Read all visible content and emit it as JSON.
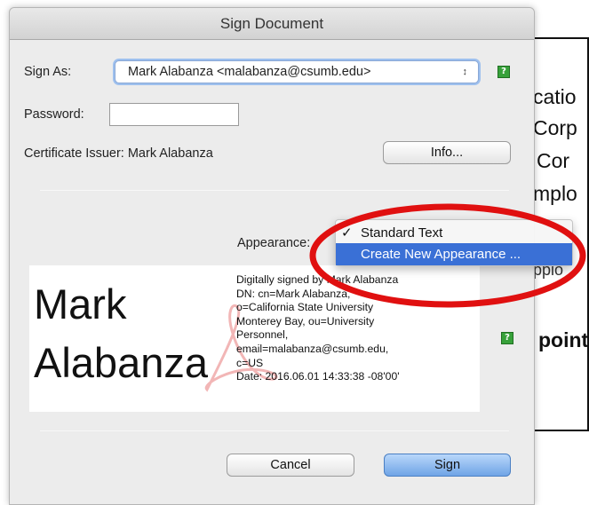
{
  "dialog": {
    "title": "Sign Document",
    "sign_as_label": "Sign As:",
    "sign_as_value": "Mark Alabanza <malabanza@csumb.edu>",
    "password_label": "Password:",
    "password_value": "",
    "certificate_issuer_label": "Certificate Issuer: Mark Alabanza",
    "info_button": "Info...",
    "appearance_label": "Appearance:",
    "cancel_button": "Cancel",
    "sign_button": "Sign",
    "help_glyph": "?"
  },
  "appearance_menu": {
    "items": [
      {
        "label": "Standard Text",
        "checked": true,
        "check_glyph": "✓"
      },
      {
        "label": "Create New Appearance ...",
        "highlighted": true
      }
    ]
  },
  "preview": {
    "name_first": "Mark",
    "name_last": "Alabanza",
    "details": [
      "Digitally signed by Mark Alabanza",
      "DN: cn=Mark Alabanza,",
      "o=California State University",
      "Monterey Bay, ou=University",
      "Personnel,",
      "email=malabanza@csumb.edu,",
      "c=US",
      "Date: 2016.06.01 14:33:38 -08'00'"
    ]
  },
  "background_document": {
    "fragments": [
      "catio",
      "Corp",
      "Cor",
      "mplo",
      "ppio",
      "point"
    ]
  },
  "colors": {
    "menu_highlight": "#3a70d6",
    "annotation_ellipse": "#e01010",
    "help_icon": "#37a13a",
    "sign_button": "#6fa4e6"
  },
  "icons": {
    "help": "help-icon",
    "popup_arrow": "updown-arrow-icon",
    "acrobat": "acrobat-logo-icon"
  }
}
